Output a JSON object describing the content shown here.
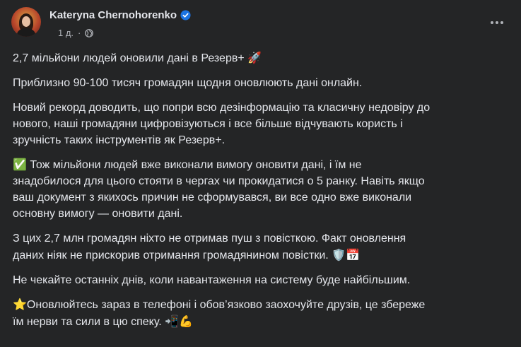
{
  "post": {
    "author": "Kateryna Chernohorenko",
    "time": "1 д.",
    "separator": "·",
    "paragraphs": [
      {
        "text": "2,7 мільйони людей оновили дані в Резерв+ ",
        "emoji": "🚀"
      },
      {
        "text": "Приблизно 90-100 тисяч громадян щодня оновлюють дані онлайн.",
        "emoji": ""
      },
      {
        "text": "Новий рекорд доводить, що попри всю дезінформацію та класичну недовіру до\nнового, наші громадяни цифровізуються і все більше відчувають користь і\nзручність таких інструментів як Резерв+.",
        "emoji": ""
      },
      {
        "text": "✅ Тож мільйони людей вже виконали вимогу оновити дані, і їм не\nзнадобилося для цього стояти в чергах чи прокидатися о 5 ранку. Навіть якщо\nваш документ з якихось причин не сформувався, ви все одно вже виконали\nосновну вимогу — оновити дані.",
        "emoji": ""
      },
      {
        "text": "З цих 2,7 млн громадян ніхто не отримав пуш з повісткою. Факт оновлення\nданих ніяк не прискорив отримання громадянином повістки. ",
        "emoji": "🛡️📅"
      },
      {
        "text": "Не чекайте останніх днів, коли навантаження на систему буде найбільшим.",
        "emoji": ""
      },
      {
        "text": "⭐Оновлюйтесь зараз в телефоні і обов’язково заохочуйте друзів, це збереже\nїм нерви та сили в цю спеку. ",
        "emoji": "📲💪"
      }
    ]
  },
  "icons": {
    "verified": "verified-badge-icon",
    "audience": "globe-icon",
    "menu": "more-options-icon"
  },
  "colors": {
    "background": "#242526",
    "text": "#e4e6eb",
    "secondary": "#b0b3b8",
    "verified": "#1b74e4"
  }
}
